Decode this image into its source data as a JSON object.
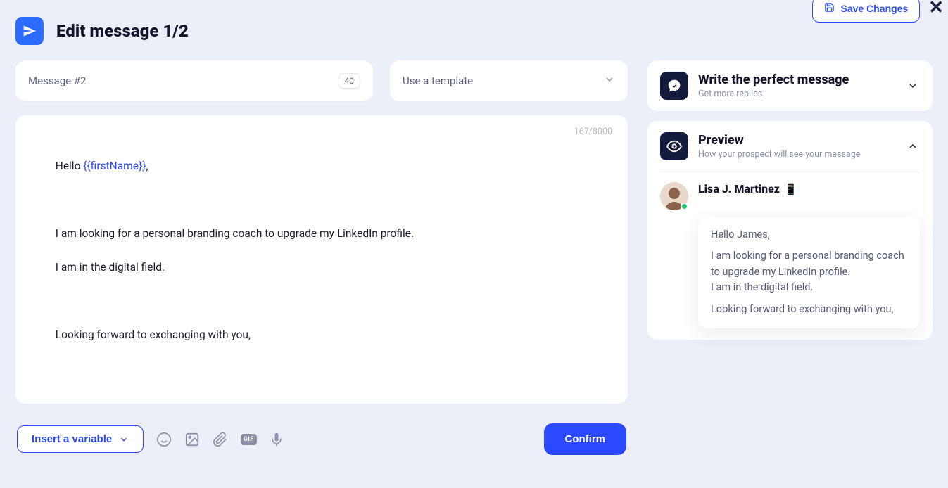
{
  "topbar": {
    "save_label": "Save Changes",
    "close_label": "✕"
  },
  "header": {
    "title": "Edit message 1/2"
  },
  "message_field": {
    "label": "Message #2",
    "count": "40"
  },
  "template_select": {
    "placeholder": "Use a template"
  },
  "editor": {
    "counter": "167/8000",
    "greeting_prefix": "Hello ",
    "variable": "{{firstName}}",
    "greeting_suffix": ",",
    "body1": "I am looking for a personal branding coach to upgrade my LinkedIn profile.",
    "body2": "I am in the digital field.",
    "closing": "Looking forward to exchanging with you,"
  },
  "toolbar": {
    "insert_variable": "Insert a variable",
    "gif_label": "GIF",
    "confirm": "Confirm"
  },
  "right": {
    "perfect": {
      "title": "Write the perfect message",
      "sub": "Get more replies"
    },
    "preview": {
      "title": "Preview",
      "sub": "How your prospect will see your message",
      "prospect_name": "Lisa J. Martinez",
      "bubble": {
        "l1": "Hello James,",
        "l2": "I am looking for a personal branding coach to upgrade my LinkedIn profile.",
        "l3": "I am in the digital field.",
        "l4": "Looking forward to exchanging with you,"
      }
    }
  }
}
